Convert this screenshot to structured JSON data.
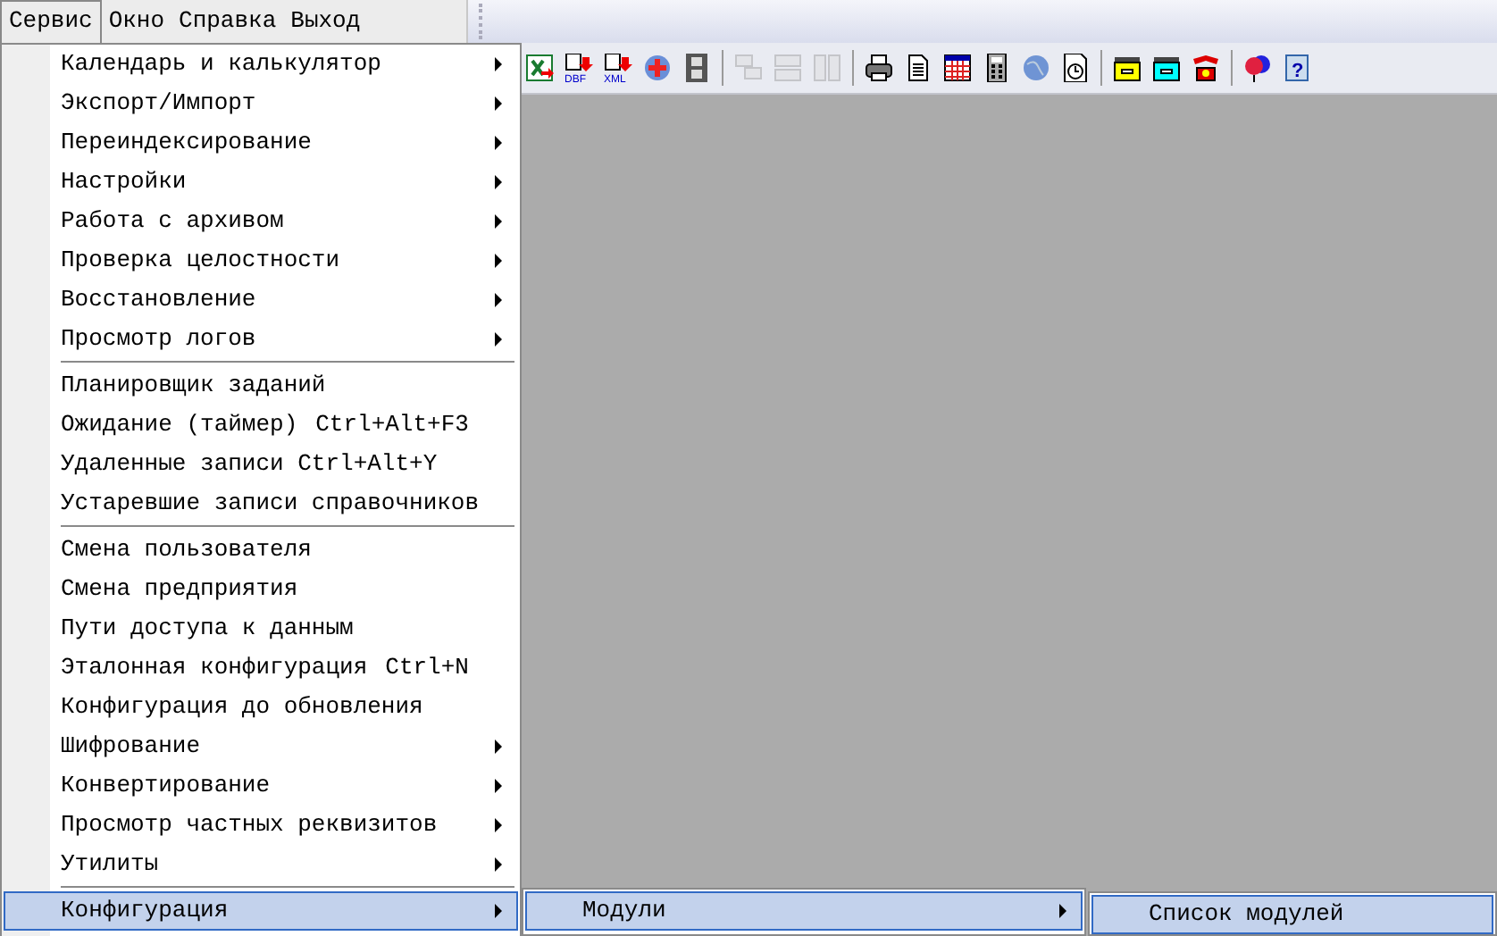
{
  "menubar": [
    {
      "label": "Сервис",
      "selected": true
    },
    {
      "label": "Окно",
      "selected": false
    },
    {
      "label": "Справка",
      "selected": false
    },
    {
      "label": "Выход",
      "selected": false
    }
  ],
  "toolbar": {
    "groups": [
      {
        "buttons": [
          {
            "disabled": false
          },
          {
            "disabled": false,
            "caption": "DBF"
          },
          {
            "disabled": false,
            "caption": "XML"
          },
          {
            "disabled": false
          },
          {
            "disabled": false
          }
        ]
      },
      {
        "buttons": [
          {
            "disabled": true
          },
          {
            "disabled": true
          },
          {
            "disabled": true
          }
        ]
      },
      {
        "buttons": [
          {
            "disabled": false
          },
          {
            "disabled": false
          },
          {
            "disabled": false
          },
          {
            "disabled": false
          },
          {
            "disabled": false
          },
          {
            "disabled": false
          }
        ]
      },
      {
        "buttons": [
          {
            "disabled": false
          },
          {
            "disabled": false
          },
          {
            "disabled": false
          }
        ]
      },
      {
        "buttons": [
          {
            "disabled": false
          },
          {
            "disabled": false,
            "caption": "?"
          }
        ]
      }
    ]
  },
  "menu": {
    "items": [
      {
        "kind": "submenu",
        "label": "Календарь и калькулятор",
        "selected": false
      },
      {
        "kind": "submenu",
        "label": "Экспорт/Импорт",
        "selected": false
      },
      {
        "kind": "submenu",
        "label": "Переиндексирование",
        "selected": false
      },
      {
        "kind": "submenu",
        "label": "Настройки",
        "selected": false
      },
      {
        "kind": "submenu",
        "label": "Работа с архивом",
        "selected": false
      },
      {
        "kind": "submenu",
        "label": "Проверка целостности",
        "selected": false
      },
      {
        "kind": "submenu",
        "label": "Восстановление",
        "selected": false
      },
      {
        "kind": "submenu",
        "label": "Просмотр логов",
        "selected": false
      },
      {
        "kind": "separator"
      },
      {
        "kind": "command",
        "label": "Планировщик заданий",
        "selected": false
      },
      {
        "kind": "command",
        "label": "Ожидание (таймер)",
        "shortcut": "Ctrl+Alt+F3",
        "selected": false
      },
      {
        "kind": "command",
        "label": "Удаленные записи Ctrl+Alt+Y",
        "selected": false
      },
      {
        "kind": "command",
        "label": "Устаревшие записи справочников",
        "selected": false
      },
      {
        "kind": "separator"
      },
      {
        "kind": "command",
        "label": "Смена пользователя",
        "selected": false
      },
      {
        "kind": "command",
        "label": "Смена предприятия",
        "selected": false
      },
      {
        "kind": "command",
        "label": "Пути доступа к данным",
        "selected": false
      },
      {
        "kind": "command",
        "label": "Эталонная конфигурация",
        "shortcut": "Ctrl+N",
        "selected": false
      },
      {
        "kind": "command",
        "label": "Конфигурация до обновления",
        "selected": false
      },
      {
        "kind": "submenu",
        "label": "Шифрование",
        "selected": false
      },
      {
        "kind": "submenu",
        "label": "Конвертирование",
        "selected": false
      },
      {
        "kind": "submenu",
        "label": "Просмотр частных реквизитов",
        "selected": false
      },
      {
        "kind": "submenu",
        "label": "Утилиты",
        "selected": false
      },
      {
        "kind": "separator"
      },
      {
        "kind": "submenu",
        "label": "Конфигурация",
        "selected": true
      }
    ]
  },
  "submenu": {
    "items": [
      {
        "kind": "submenu",
        "label": "Модули",
        "selected": true
      }
    ]
  },
  "submenu_2": {
    "items": [
      {
        "kind": "command",
        "label": "Список модулей",
        "selected": true
      }
    ]
  }
}
